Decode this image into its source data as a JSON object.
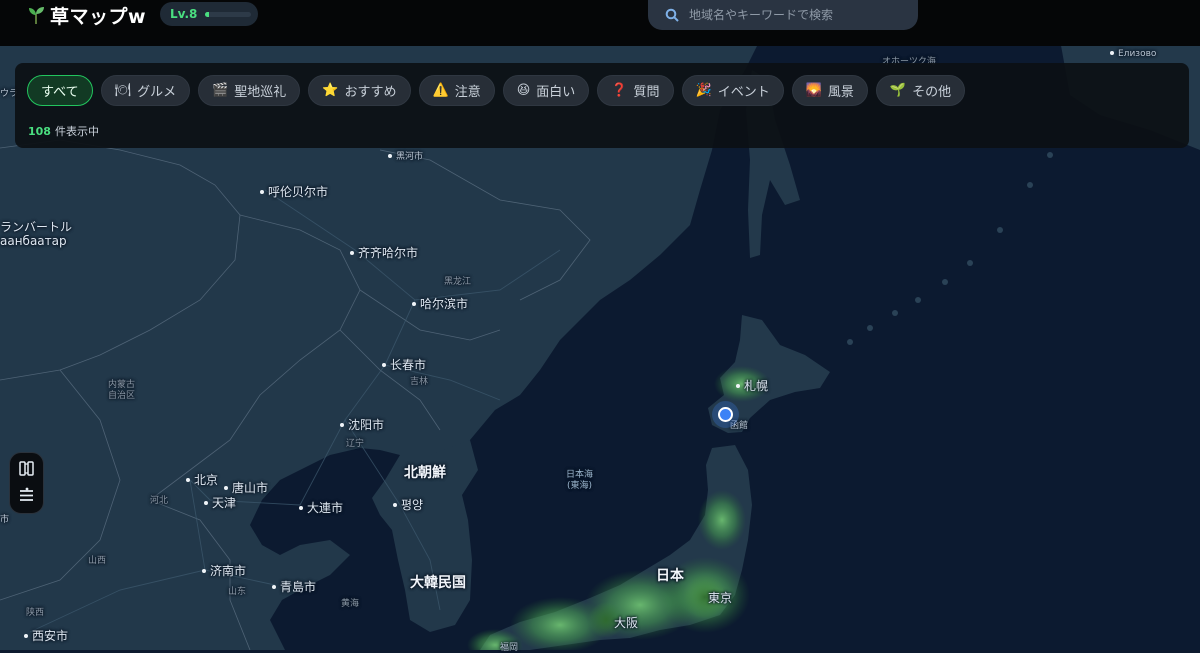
{
  "app": {
    "title": "草マップw",
    "level_label": "Lv.8",
    "level_progress": 0.08
  },
  "search": {
    "placeholder": "地域名やキーワードで検索"
  },
  "filters": {
    "chips": [
      {
        "label": "すべて",
        "icon": "",
        "icon_name": "none",
        "active": true
      },
      {
        "label": "グルメ",
        "icon": "🍽",
        "icon_name": "bowl-icon",
        "active": false
      },
      {
        "label": "聖地巡礼",
        "icon": "🎬",
        "icon_name": "clapper-icon",
        "active": false
      },
      {
        "label": "おすすめ",
        "icon": "⭐",
        "icon_name": "star-icon",
        "active": false
      },
      {
        "label": "注意",
        "icon": "⚠️",
        "icon_name": "warning-icon",
        "active": false
      },
      {
        "label": "面白い",
        "icon": "😆",
        "icon_name": "laugh-icon",
        "active": false
      },
      {
        "label": "質問",
        "icon": "❓",
        "icon_name": "question-icon",
        "active": false
      },
      {
        "label": "イベント",
        "icon": "🎉",
        "icon_name": "party-icon",
        "active": false
      },
      {
        "label": "風景",
        "icon": "🌄",
        "icon_name": "landscape-icon",
        "active": false
      },
      {
        "label": "その他",
        "icon": "🌱",
        "icon_name": "sprout-icon",
        "active": false
      }
    ],
    "count_number": "108",
    "count_suffix": "件表示中"
  },
  "colors": {
    "accent": "#22c55e",
    "accent_text": "#4ade80",
    "marker": "#3b82f6",
    "sea": "#0d1a2e",
    "land": "#22384a"
  },
  "map": {
    "labels": [
      {
        "text": "オホーツク海",
        "cls": "dim"
      },
      {
        "text": "Елизово",
        "cls": "small dot"
      },
      {
        "text": "ランバートル",
        "cls": ""
      },
      {
        "text": "аанбаатар",
        "cls": ""
      },
      {
        "text": "呼伦贝尔市",
        "cls": "dot"
      },
      {
        "text": "黑河市",
        "cls": "small dot"
      },
      {
        "text": "齐齐哈尔市",
        "cls": "dot"
      },
      {
        "text": "哈尔滨市",
        "cls": "dot"
      },
      {
        "text": "黑龙江",
        "cls": "dim"
      },
      {
        "text": "长春市",
        "cls": "dot"
      },
      {
        "text": "吉林",
        "cls": "dim"
      },
      {
        "text": "内蒙古\n自治区",
        "cls": "dim"
      },
      {
        "text": "沈阳市",
        "cls": "dot"
      },
      {
        "text": "辽宁",
        "cls": "dim"
      },
      {
        "text": "北朝鮮",
        "cls": "country"
      },
      {
        "text": "北京",
        "cls": "dot"
      },
      {
        "text": "唐山市",
        "cls": "dot"
      },
      {
        "text": "天津",
        "cls": "dot"
      },
      {
        "text": "河北",
        "cls": "dim"
      },
      {
        "text": "大連市",
        "cls": "dot"
      },
      {
        "text": "평양",
        "cls": "dot"
      },
      {
        "text": "日本海\n(東海)",
        "cls": "sea"
      },
      {
        "text": "札幌",
        "cls": "dot"
      },
      {
        "text": "函館",
        "cls": "small dot"
      },
      {
        "text": "山西",
        "cls": "dim"
      },
      {
        "text": "济南市",
        "cls": "dot"
      },
      {
        "text": "青島市",
        "cls": "dot"
      },
      {
        "text": "山东",
        "cls": "dim"
      },
      {
        "text": "黄海",
        "cls": "dim"
      },
      {
        "text": "大韓民国",
        "cls": "country"
      },
      {
        "text": "日本",
        "cls": "country"
      },
      {
        "text": "東京",
        "cls": ""
      },
      {
        "text": "大阪",
        "cls": ""
      },
      {
        "text": "陕西",
        "cls": "dim"
      },
      {
        "text": "西安市",
        "cls": "dot"
      },
      {
        "text": "福岡",
        "cls": "small"
      },
      {
        "text": "市",
        "cls": "small"
      },
      {
        "text": "ウラ",
        "cls": "small"
      }
    ],
    "heat_spots": [
      {
        "region": "札幌",
        "intensity": 0.7
      },
      {
        "region": "東京",
        "intensity": 1.0
      },
      {
        "region": "大阪",
        "intensity": 0.9
      },
      {
        "region": "東北",
        "intensity": 0.5
      },
      {
        "region": "福岡",
        "intensity": 0.6
      }
    ]
  },
  "side_tools": {
    "icons": [
      "map-book-icon",
      "menu-list-icon"
    ]
  }
}
